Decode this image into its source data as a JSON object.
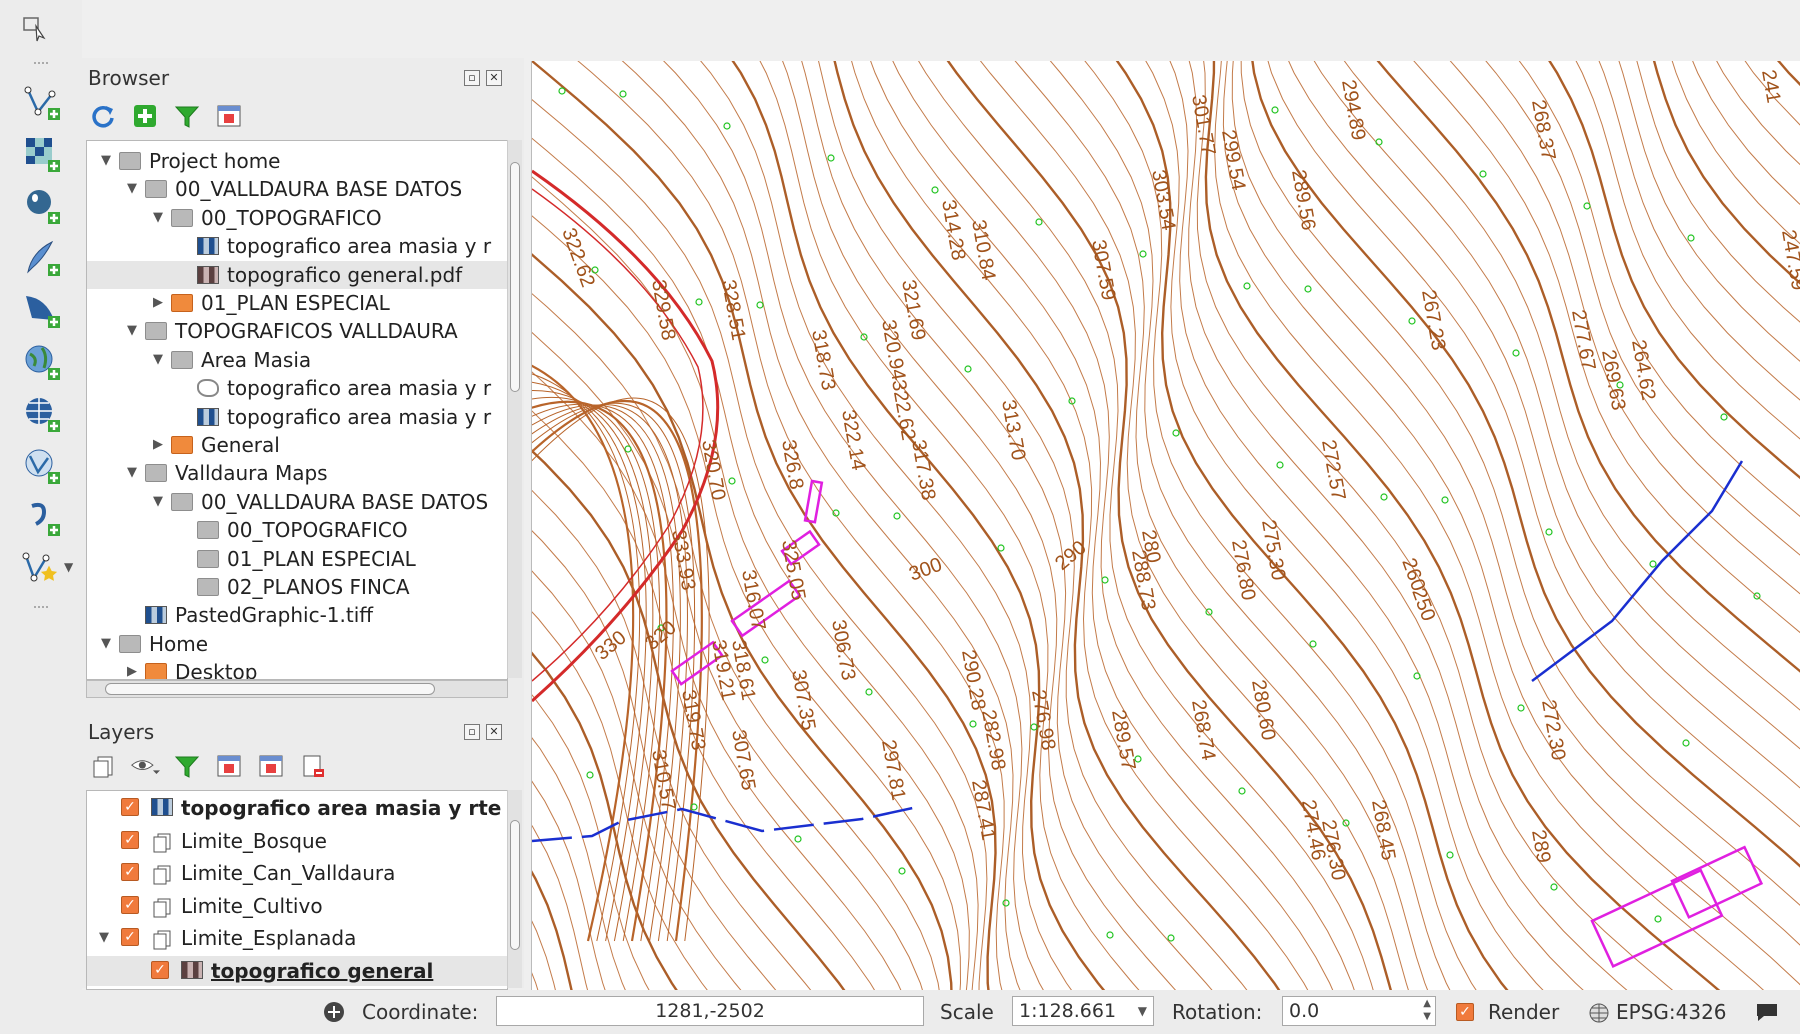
{
  "browser": {
    "title": "Browser",
    "toolbar": [
      "refresh-icon",
      "add-selected-icon",
      "filter-icon",
      "collapse-all-icon"
    ],
    "tree": [
      {
        "label": "Project home",
        "level": 0,
        "expanded": true,
        "icon": "folder"
      },
      {
        "label": "00_VALLDAURA BASE DATOS",
        "level": 1,
        "expanded": true,
        "icon": "folder"
      },
      {
        "label": "00_TOPOGRAFICO",
        "level": 2,
        "expanded": true,
        "icon": "folder"
      },
      {
        "label": "topografico area masia y r",
        "level": 3,
        "icon": "raster"
      },
      {
        "label": "topografico general.pdf",
        "level": 3,
        "icon": "raster-pdf",
        "selected": true
      },
      {
        "label": "01_PLAN ESPECIAL",
        "level": 2,
        "expanded": false,
        "icon": "folder-orange"
      },
      {
        "label": "TOPOGRAFICOS VALLDAURA",
        "level": 1,
        "expanded": true,
        "icon": "folder"
      },
      {
        "label": "Area Masia",
        "level": 2,
        "expanded": true,
        "icon": "folder"
      },
      {
        "label": "topografico area masia y r",
        "level": 3,
        "icon": "vector"
      },
      {
        "label": "topografico area masia y r",
        "level": 3,
        "icon": "raster"
      },
      {
        "label": "General",
        "level": 2,
        "expanded": false,
        "icon": "folder-orange"
      },
      {
        "label": "Valldaura Maps",
        "level": 1,
        "expanded": true,
        "icon": "folder"
      },
      {
        "label": "00_VALLDAURA BASE DATOS",
        "level": 2,
        "expanded": true,
        "icon": "folder"
      },
      {
        "label": "00_TOPOGRAFICO",
        "level": 3,
        "icon": "folder"
      },
      {
        "label": "01_PLAN ESPECIAL",
        "level": 3,
        "icon": "folder"
      },
      {
        "label": "02_PLANOS FINCA",
        "level": 3,
        "icon": "folder"
      },
      {
        "label": "PastedGraphic-1.tiff",
        "level": 1,
        "icon": "raster"
      },
      {
        "label": "Home",
        "level": 0,
        "expanded": true,
        "icon": "folder"
      },
      {
        "label": "Desktop",
        "level": 1,
        "expanded": false,
        "icon": "folder-orange"
      }
    ]
  },
  "layers": {
    "title": "Layers",
    "toolbar": [
      "open-layer-styling-icon",
      "visibility-eye-icon",
      "filter-legend-icon",
      "expand-all-icon",
      "collapse-all-icon",
      "remove-layer-icon"
    ],
    "items": [
      {
        "label": "topografico area masia y rte",
        "level": 1,
        "checked": true,
        "icon": "raster",
        "bold": true
      },
      {
        "label": "Limite_Bosque",
        "level": 1,
        "checked": true,
        "icon": "vector-layer"
      },
      {
        "label": "Limite_Can_Valldaura",
        "level": 1,
        "checked": true,
        "icon": "vector-layer"
      },
      {
        "label": "Limite_Cultivo",
        "level": 1,
        "checked": true,
        "icon": "vector-layer"
      },
      {
        "label": "Limite_Esplanada",
        "level": 1,
        "checked": true,
        "icon": "vector-layer",
        "expanded": true
      },
      {
        "label": "topografico general",
        "level": 2,
        "checked": true,
        "icon": "raster-pdf",
        "bold": true,
        "selected": true
      }
    ]
  },
  "left_toolbar": [
    "add-vector-layer-icon",
    "add-raster-layer-icon",
    "add-postgis-layer-icon",
    "add-spatialite-layer-icon",
    "add-mssql-layer-icon",
    "add-wms-layer-icon",
    "add-wcs-layer-icon",
    "add-wfs-layer-icon",
    "add-delimited-text-icon",
    "new-vector-layer-icon"
  ],
  "map": {
    "labels": [
      "301.77",
      "299.54",
      "294.89",
      "289.56",
      "268.37",
      "241",
      "247.59",
      "322.62",
      "303.54",
      "307.59",
      "314.28",
      "310.84",
      "329.58",
      "328.51",
      "321.69",
      "320.94",
      "267.23",
      "277.67",
      "269.63",
      "264.62",
      "318.73",
      "322.62",
      "313.70",
      "272.57",
      "320.70",
      "322.14",
      "317.38",
      "326.8",
      "275.30",
      "276.80",
      "260",
      "250",
      "333.93",
      "325.05",
      "316.07",
      "318.61",
      "300",
      "290",
      "288.73",
      "280",
      "330",
      "320",
      "319.21",
      "306.73",
      "307.35",
      "290.28",
      "282.98",
      "276.98",
      "289.57",
      "268.74",
      "280.60",
      "272.30",
      "319.73",
      "310.57",
      "307.65",
      "297.81",
      "287.41",
      "274.46",
      "276.30",
      "268.45",
      "289"
    ]
  },
  "status": {
    "coordinate_label": "Coordinate:",
    "coordinate_value": "1281,-2502",
    "scale_label": "Scale",
    "scale_value": "1:128.661",
    "rotation_label": "Rotation:",
    "rotation_value": "0.0",
    "render_label": "Render",
    "crs": "EPSG:4326"
  },
  "colors": {
    "contour": "#b8642a",
    "contour_major": "#a8551c",
    "road": "#d42a2a",
    "vegetation": "#22c422",
    "buildings": "#e020e0",
    "stream": "#1a2fd0",
    "checkbox": "#f07a3c"
  }
}
